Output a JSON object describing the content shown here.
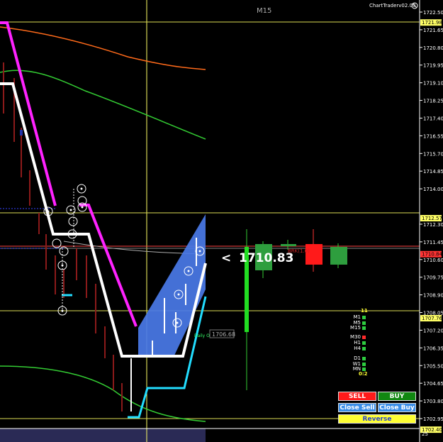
{
  "header": {
    "timeframe": "M15",
    "brand": "ChartTraderv02.00"
  },
  "price_axis": {
    "ticks": [
      "1722.50",
      "1721.65",
      "1720.80",
      "1719.95",
      "1719.10",
      "1718.25",
      "1717.40",
      "1716.55",
      "1715.70",
      "1714.85",
      "1714.00",
      "1712.30",
      "1711.45",
      "1710.60",
      "1709.75",
      "1708.90",
      "1708.05",
      "1707.20",
      "1706.35",
      "1705.50",
      "1704.65",
      "1703.80",
      "1702.95"
    ],
    "markers": [
      {
        "label": "1721.98",
        "color": "#ffff66"
      },
      {
        "label": "1712.57",
        "color": "#ffff66"
      },
      {
        "label": "1710.84",
        "color": "#ff3333"
      },
      {
        "label": "1707.76",
        "color": "#ffff66"
      },
      {
        "label": "1702.40",
        "color": "#ffff66"
      }
    ],
    "bottom_value": "25"
  },
  "current_price": {
    "arrow": "<",
    "value": "1710.83"
  },
  "daily_open": {
    "label": "Daily Open",
    "value": "1706.68"
  },
  "mini_label": "BRK(1.0)",
  "timeframes": {
    "top_count": "11",
    "items": [
      {
        "label": "M1",
        "color": "#2ecc40"
      },
      {
        "label": "M5",
        "color": "#2ecc40"
      },
      {
        "label": "M15",
        "color": "#2ecc40"
      },
      {
        "label": "M30",
        "color": "#ff2a2a"
      },
      {
        "label": "H1",
        "color": "#2ecc40"
      },
      {
        "label": "H4",
        "color": "#2ecc40"
      },
      {
        "label": "D1",
        "color": "#2ecc40"
      },
      {
        "label": "W1",
        "color": "#2ecc40"
      },
      {
        "label": "MN",
        "color": "#2ecc40"
      }
    ],
    "score": "0:2"
  },
  "trade_panel": {
    "sell_label": "SELL",
    "buy_label": "BUY",
    "close_sell_label": "Close Sell",
    "close_buy_label": "Close Buy",
    "reverse_label": "Reverse"
  },
  "colors": {
    "sell": "#ff1a1a",
    "buy": "#118811",
    "close": "#3a8ee8",
    "reverse": "#ffff33",
    "bull_candle": "#2e9e3e",
    "bear_candle": "#ff1a1a"
  }
}
